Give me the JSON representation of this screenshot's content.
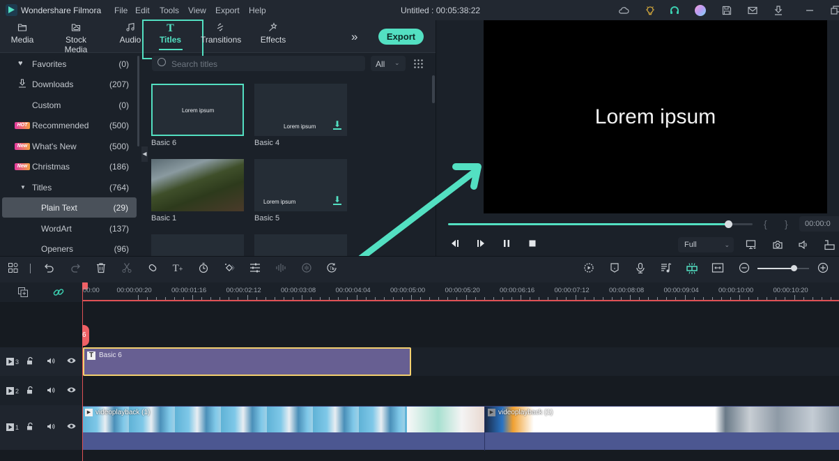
{
  "app": {
    "name": "Wondershare Filmora",
    "menu": [
      "File",
      "Edit",
      "Tools",
      "View",
      "Export",
      "Help"
    ],
    "document_title": "Untitled : 00:05:38:22",
    "title_icons": [
      "cloud-icon",
      "lightbulb-icon",
      "headset-icon",
      "avatar-icon",
      "save-icon",
      "mail-icon",
      "download-icon",
      "minimize-icon",
      "restore-icon"
    ]
  },
  "media_tabs": [
    {
      "label": "Media",
      "icon": "folder-icon"
    },
    {
      "label": "Stock Media",
      "icon": "stock-media-icon"
    },
    {
      "label": "Audio",
      "icon": "music-note-icon"
    },
    {
      "label": "Titles",
      "icon": "text-t-icon",
      "active": true
    },
    {
      "label": "Transitions",
      "icon": "transitions-icon"
    },
    {
      "label": "Effects",
      "icon": "effects-icon"
    }
  ],
  "toolbar": {
    "export_label": "Export",
    "more": "»"
  },
  "categories": [
    {
      "label": "Favorites",
      "count": "(0)",
      "icon": "heart-icon"
    },
    {
      "label": "Downloads",
      "count": "(207)",
      "icon": "download-icon"
    },
    {
      "label": "Custom",
      "count": "(0)"
    },
    {
      "label": "Recommended",
      "count": "(500)",
      "badge": "HOT"
    },
    {
      "label": "What's New",
      "count": "(500)",
      "badge": "New"
    },
    {
      "label": "Christmas",
      "count": "(186)",
      "badge": "New"
    },
    {
      "label": "Titles",
      "count": "(764)",
      "expanded": true
    },
    {
      "label": "Plain Text",
      "count": "(29)",
      "selected": true
    },
    {
      "label": "WordArt",
      "count": "(137)"
    },
    {
      "label": "Openers",
      "count": "(96)"
    }
  ],
  "search": {
    "placeholder": "Search titles",
    "filter": "All"
  },
  "titles": [
    {
      "name": "Basic 6",
      "preview": "Lorem ipsum",
      "selected": true
    },
    {
      "name": "Basic 4",
      "preview": "Lorem ipsum",
      "download": true
    },
    {
      "name": "Basic 1",
      "preview": "",
      "image": true
    },
    {
      "name": "Basic 5",
      "preview": "Lorem ipsum",
      "download": true
    }
  ],
  "preview": {
    "text": "Lorem ipsum",
    "progress": 0.92,
    "bracket_in": "{",
    "bracket_out": "}",
    "timecode": "00:00:0",
    "quality": "Full",
    "accent": "#53e0c2"
  },
  "timeline": {
    "ruler": [
      "00:00",
      "00:00:00:20",
      "00:00:01:16",
      "00:00:02:12",
      "00:00:03:08",
      "00:00:04:04",
      "00:00:05:00",
      "00:00:05:20",
      "00:00:06:16",
      "00:00:07:12",
      "00:00:08:08",
      "00:00:09:04",
      "00:00:10:00",
      "00:00:10:20"
    ],
    "zoom_level": 0.7,
    "tracks": [
      {
        "number": "3",
        "clip": "Basic 6"
      },
      {
        "number": "2"
      },
      {
        "number": "1",
        "clips": [
          "videoplayback (1)",
          "videoplayback (1)"
        ]
      }
    ],
    "playhead_label": "6"
  }
}
